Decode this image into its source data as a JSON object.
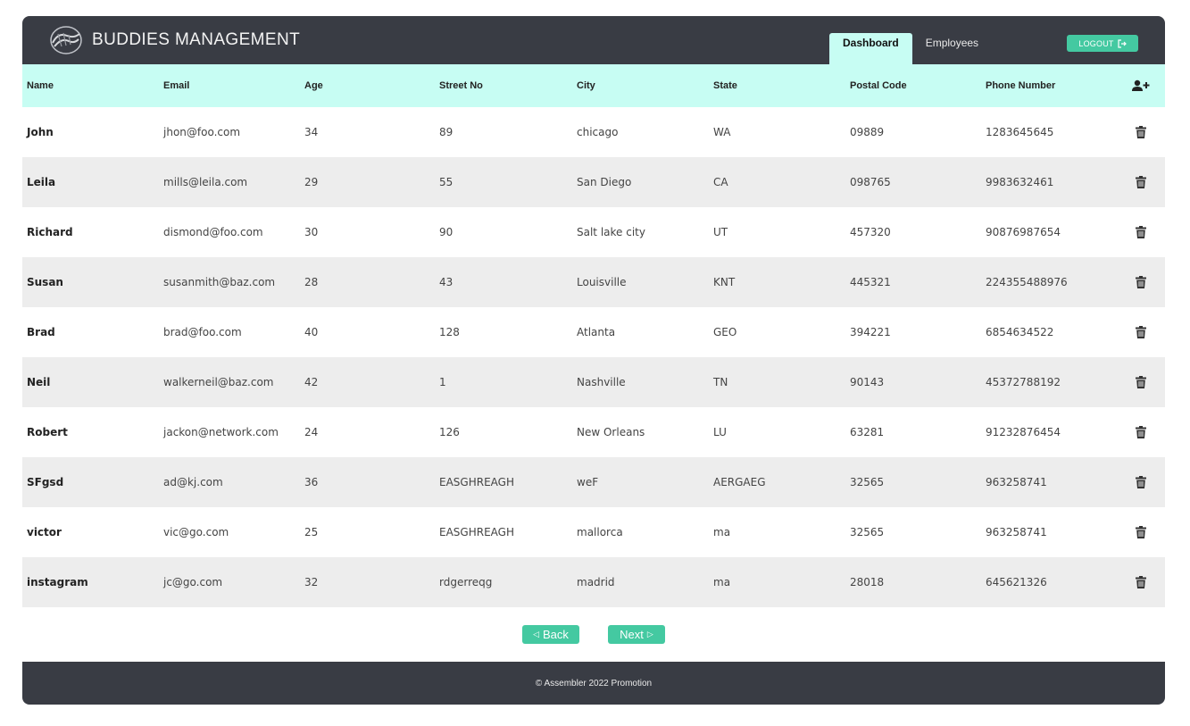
{
  "header": {
    "brand": "BUDDIES MANAGEMENT",
    "tabs": [
      "Dashboard",
      "Employees"
    ],
    "active_tab": "Dashboard",
    "logout_label": "LOGOUT",
    "logo_icon": "handshake-logo-icon",
    "logout_icon": "sign-out-icon"
  },
  "table": {
    "columns": [
      "Name",
      "Email",
      "Age",
      "Street No",
      "City",
      "State",
      "Postal Code",
      "Phone Number"
    ],
    "add_icon": "user-plus-icon",
    "delete_icon": "trash-icon",
    "rows": [
      [
        "John",
        "jhon@foo.com",
        "34",
        "89",
        "chicago",
        "WA",
        "09889",
        "1283645645"
      ],
      [
        "Leila",
        "mills@leila.com",
        "29",
        "55",
        "San Diego",
        "CA",
        "098765",
        "9983632461"
      ],
      [
        "Richard",
        "dismond@foo.com",
        "30",
        "90",
        "Salt lake city",
        "UT",
        "457320",
        "90876987654"
      ],
      [
        "Susan",
        "susanmith@baz.com",
        "28",
        "43",
        "Louisville",
        "KNT",
        "445321",
        "224355488976"
      ],
      [
        "Brad",
        "brad@foo.com",
        "40",
        "128",
        "Atlanta",
        "GEO",
        "394221",
        "6854634522"
      ],
      [
        "Neil",
        "walkerneil@baz.com",
        "42",
        "1",
        "Nashville",
        "TN",
        "90143",
        "45372788192"
      ],
      [
        "Robert",
        "jackon@network.com",
        "24",
        "126",
        "New Orleans",
        "LU",
        "63281",
        "91232876454"
      ],
      [
        "SFgsd",
        "ad@kj.com",
        "36",
        "EASGHREAGH",
        "weF",
        "AERGAEG",
        "32565",
        "963258741"
      ],
      [
        "victor",
        "vic@go.com",
        "25",
        "EASGHREAGH",
        "mallorca",
        "ma",
        "32565",
        "963258741"
      ],
      [
        "instagram",
        "jc@go.com",
        "32",
        "rdgerreqg",
        "madrid",
        "ma",
        "28018",
        "645621326"
      ]
    ]
  },
  "pagination": {
    "back_label": "Back",
    "next_label": "Next"
  },
  "footer": {
    "text": "© Assembler 2022 Promotion"
  },
  "colors": {
    "header_bg": "#393c44",
    "table_header_bg": "#c7fdf3",
    "accent": "#44c9a1",
    "row_alt": "#ededed"
  }
}
